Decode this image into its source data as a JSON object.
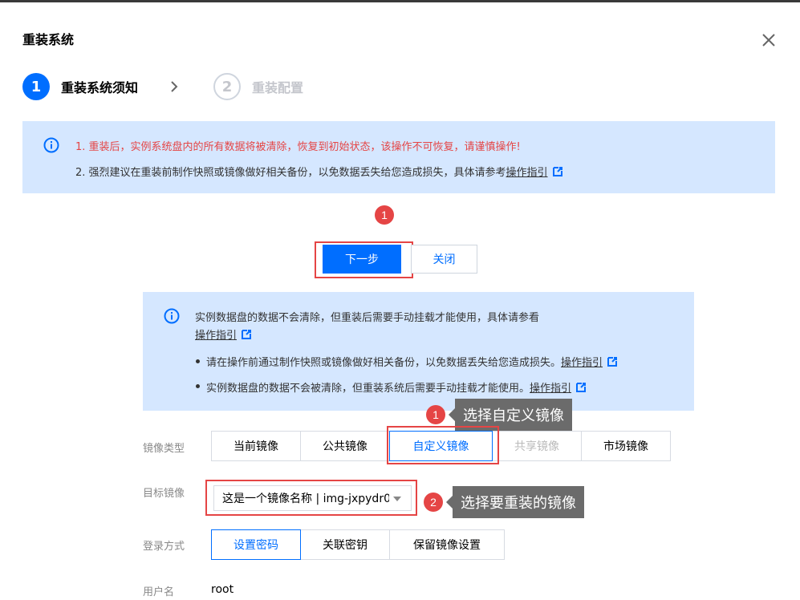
{
  "dialog": {
    "title": "重装系统"
  },
  "stepper": {
    "steps": [
      {
        "number": "1",
        "label": "重装系统须知",
        "state": "active"
      },
      {
        "number": "2",
        "label": "重装配置",
        "state": "inactive"
      }
    ]
  },
  "notice_top": {
    "line1": "1. 重装后，实例系统盘内的所有数据将被清除，恢复到初始状态，该操作不可恢复，请谨慎操作!",
    "line2_prefix": "2. 强烈建议在重装前制作快照或镜像做好相关备份，以免数据丢失给您造成损失，具体请参考",
    "line2_link": "操作指引"
  },
  "annotations": {
    "badge1_top": "1",
    "badge1_image": "1",
    "badge2_image": "2",
    "tooltip_image_type": "选择自定义镜像",
    "tooltip_target_image": "选择要重装的镜像"
  },
  "buttons": {
    "next": "下一步",
    "close": "关闭"
  },
  "notice_data_disk": {
    "intro": "实例数据盘的数据不会清除，但重装后需要手动挂载才能使用，具体请参看",
    "intro_link": "操作指引",
    "bullet1": "请在操作前通过制作快照或镜像做好相关备份，以免数据丢失给您造成损失。",
    "bullet1_link": "操作指引",
    "bullet2": "实例数据盘的数据不会被清除，但重装系统后需要手动挂载才能使用。",
    "bullet2_link": "操作指引"
  },
  "form": {
    "image_type_label": "镜像类型",
    "image_types": [
      "当前镜像",
      "公共镜像",
      "自定义镜像",
      "共享镜像",
      "市场镜像"
    ],
    "image_type_selected": "自定义镜像",
    "image_type_disabled": "共享镜像",
    "target_image_label": "目标镜像",
    "target_image_value": "这是一个镜像名称 | img-jxpydr0",
    "login_label": "登录方式",
    "login_methods": [
      "设置密码",
      "关联密钥",
      "保留镜像设置"
    ],
    "login_selected": "设置密码",
    "username_label": "用户名",
    "username_value": "root"
  },
  "colors": {
    "primary": "#006eff",
    "danger": "#e54545",
    "notice_bg": "#d5e7ff",
    "tooltip_bg": "#6b6b6b"
  },
  "icons": [
    "close-icon",
    "chevron-right-icon",
    "info-icon",
    "external-link-icon",
    "caret-down-icon"
  ]
}
